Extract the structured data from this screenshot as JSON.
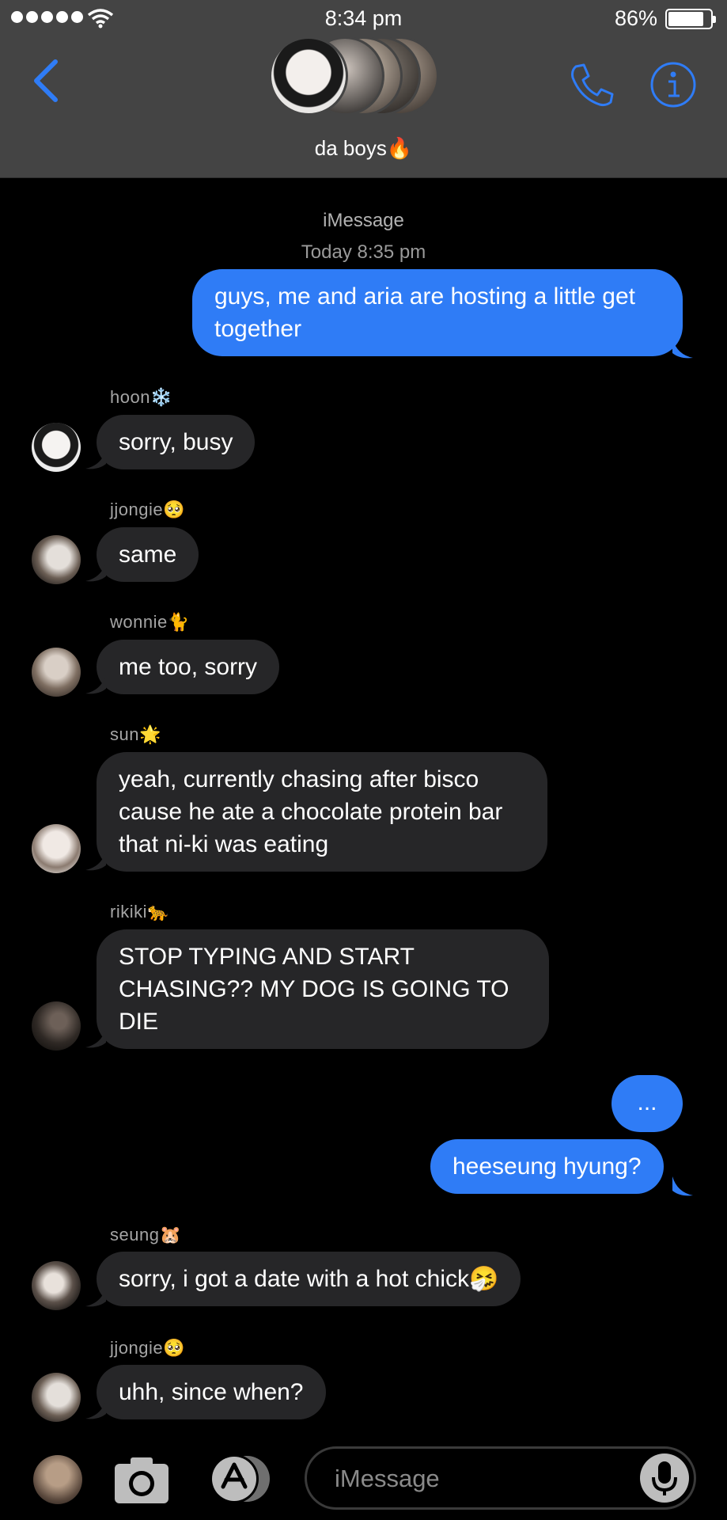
{
  "status_bar": {
    "time": "8:34 pm",
    "battery": "86%"
  },
  "header": {
    "group_name": "da boys🔥"
  },
  "thread": {
    "service": "iMessage",
    "timestamp": "Today 8:35 pm"
  },
  "messages": [
    {
      "side": "out",
      "text": "guys, me and aria are hosting a little get together"
    },
    {
      "side": "in",
      "sender": "hoon❄️",
      "text": "sorry, busy"
    },
    {
      "side": "in",
      "sender": "jjongie🥺",
      "text": "same"
    },
    {
      "side": "in",
      "sender": "wonnie🐈",
      "text": "me too, sorry"
    },
    {
      "side": "in",
      "sender": "sun🌟",
      "text": "yeah, currently chasing after bisco cause he ate a chocolate protein bar that ni-ki was eating"
    },
    {
      "side": "in",
      "sender": "rikiki🐆",
      "text": "STOP TYPING AND START CHASING?? MY DOG IS GOING TO DIE"
    },
    {
      "side": "out",
      "text": "..."
    },
    {
      "side": "out",
      "text": "heeseung hyung?"
    },
    {
      "side": "in",
      "sender": "seung🐹",
      "text": "sorry, i got a date with a hot chick🤧"
    },
    {
      "side": "in",
      "sender": "jjongie🥺",
      "text": "uhh, since when?"
    }
  ],
  "composer": {
    "placeholder": "iMessage"
  },
  "icons": [
    "back-chevron-icon",
    "phone-icon",
    "info-icon",
    "camera-icon",
    "app-store-icon",
    "microphone-icon",
    "wifi-icon",
    "battery-icon"
  ],
  "colors": {
    "accent": "#2f7cf6",
    "header_bg": "#444444",
    "incoming_bubble": "#262628",
    "outgoing_bubble": "#2f7cf6"
  }
}
